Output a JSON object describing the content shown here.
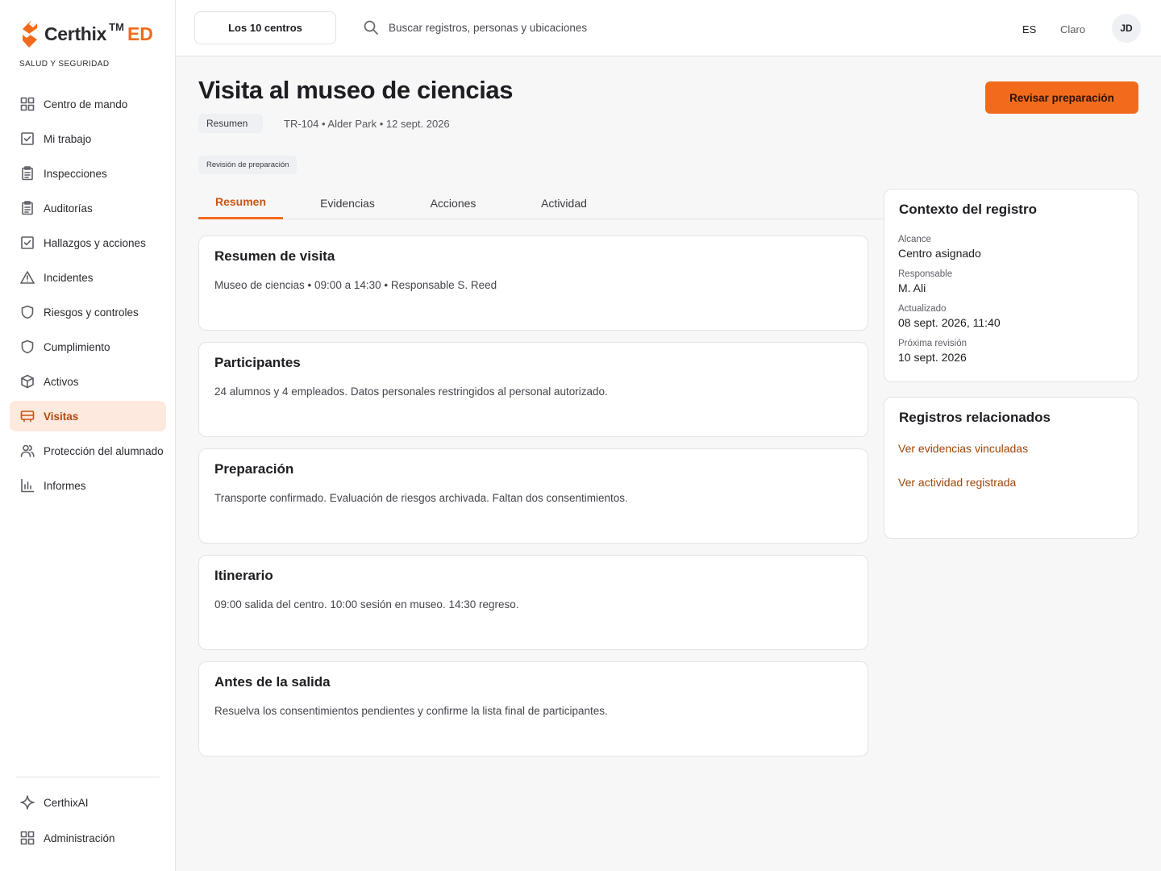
{
  "brand": {
    "name": "Certhix",
    "tm": "TM",
    "suffix": "ED",
    "tagline": "SALUD Y SEGURIDAD",
    "accent": "#f26b1d"
  },
  "sidebar": {
    "items": [
      {
        "label": "Centro de mando",
        "icon": "grid-icon"
      },
      {
        "label": "Mi trabajo",
        "icon": "checkbox-icon"
      },
      {
        "label": "Inspecciones",
        "icon": "clipboard-icon"
      },
      {
        "label": "Auditorías",
        "icon": "clipboard-icon"
      },
      {
        "label": "Hallazgos y acciones",
        "icon": "checkbox-icon"
      },
      {
        "label": "Incidentes",
        "icon": "warning-icon"
      },
      {
        "label": "Riesgos y controles",
        "icon": "shield-icon"
      },
      {
        "label": "Cumplimiento",
        "icon": "shield-icon"
      },
      {
        "label": "Activos",
        "icon": "cube-icon"
      },
      {
        "label": "Visitas",
        "icon": "bus-icon",
        "active": true
      },
      {
        "label": "Protección del alumnado",
        "icon": "users-icon"
      },
      {
        "label": "Informes",
        "icon": "bar-chart-icon"
      }
    ],
    "bottom": [
      {
        "label": "CerthixAI",
        "icon": "sparkle-icon"
      },
      {
        "label": "Administración",
        "icon": "grid-icon"
      }
    ]
  },
  "topbar": {
    "site_selector": "Los 10 centros",
    "search_placeholder": "Buscar registros, personas y ubicaciones",
    "language": "ES",
    "theme": "Claro",
    "avatar_initials": "JD"
  },
  "header": {
    "title": "Visita al museo de ciencias",
    "chip": "Resumen",
    "meta": "TR-104 • Alder Park • 12 sept. 2026",
    "status_chip": "Revisión de preparación",
    "primary_action": "Revisar preparación"
  },
  "tabs": [
    {
      "label": "Resumen",
      "active": true
    },
    {
      "label": "Evidencias"
    },
    {
      "label": "Acciones"
    },
    {
      "label": "Actividad"
    }
  ],
  "cards": [
    {
      "title": "Resumen de visita",
      "body": "Museo de ciencias • 09:00 a 14:30 • Responsable S. Reed"
    },
    {
      "title": "Participantes",
      "body": "24 alumnos y 4 empleados. Datos personales restringidos al personal autorizado."
    },
    {
      "title": "Preparación",
      "body": "Transporte confirmado. Evaluación de riesgos archivada. Faltan dos consentimientos."
    },
    {
      "title": "Itinerario",
      "body": "09:00 salida del centro. 10:00 sesión en museo. 14:30 regreso."
    },
    {
      "title": "Antes de la salida",
      "body": "Resuelva los consentimientos pendientes y confirme la lista final de participantes."
    }
  ],
  "context": {
    "title": "Contexto del registro",
    "items": [
      {
        "key": "Alcance",
        "value": "Centro asignado"
      },
      {
        "key": "Responsable",
        "value": "M. Ali"
      },
      {
        "key": "Actualizado",
        "value": "08 sept. 2026, 11:40"
      },
      {
        "key": "Próxima revisión",
        "value": "10 sept. 2026"
      }
    ]
  },
  "related": {
    "title": "Registros relacionados",
    "links": [
      "Ver evidencias vinculadas",
      "Ver actividad registrada"
    ]
  }
}
